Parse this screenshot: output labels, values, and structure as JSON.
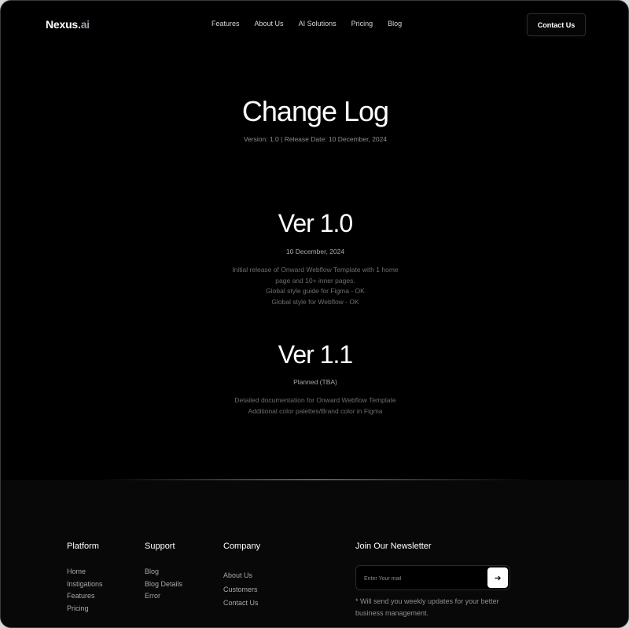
{
  "nav": {
    "logo_main": "Nexus.",
    "logo_suffix": "ai",
    "links": [
      "Features",
      "About Us",
      "AI Solutions",
      "Pricing",
      "Blog"
    ],
    "contact_label": "Contact Us"
  },
  "hero": {
    "title": "Change Log",
    "meta": "Version: 1.0 | Release Date: 10 December, 2024"
  },
  "versions": [
    {
      "title": "Ver 1.0",
      "date": "10 December, 2024",
      "lines": [
        "Initial release of Onward Webflow Template with 1 home",
        "page and 10+ inner pages.",
        "Global style guide for Figma - OK",
        "Global style for Webflow - OK"
      ]
    },
    {
      "title": "Ver 1.1",
      "date": "Planned (TBA)",
      "lines": [
        "Detailed documentation for Onward Webflow Template",
        "Additional color palettes/Brand color in Figma"
      ]
    }
  ],
  "footer": {
    "platform": {
      "heading": "Platform",
      "links": [
        "Home",
        "Instigations",
        "Features",
        "Pricing"
      ]
    },
    "support": {
      "heading": "Support",
      "links": [
        "Blog",
        "Blog Details",
        "Error"
      ]
    },
    "company": {
      "heading": "Company",
      "links": [
        "About Us",
        "Customers",
        "Contact Us"
      ]
    },
    "newsletter": {
      "heading": "Join Our Newsletter",
      "placeholder": "Enter Your mail",
      "send_icon": "arrow-right-icon",
      "note": "*  Will send you weekly updates for your better business management."
    }
  }
}
